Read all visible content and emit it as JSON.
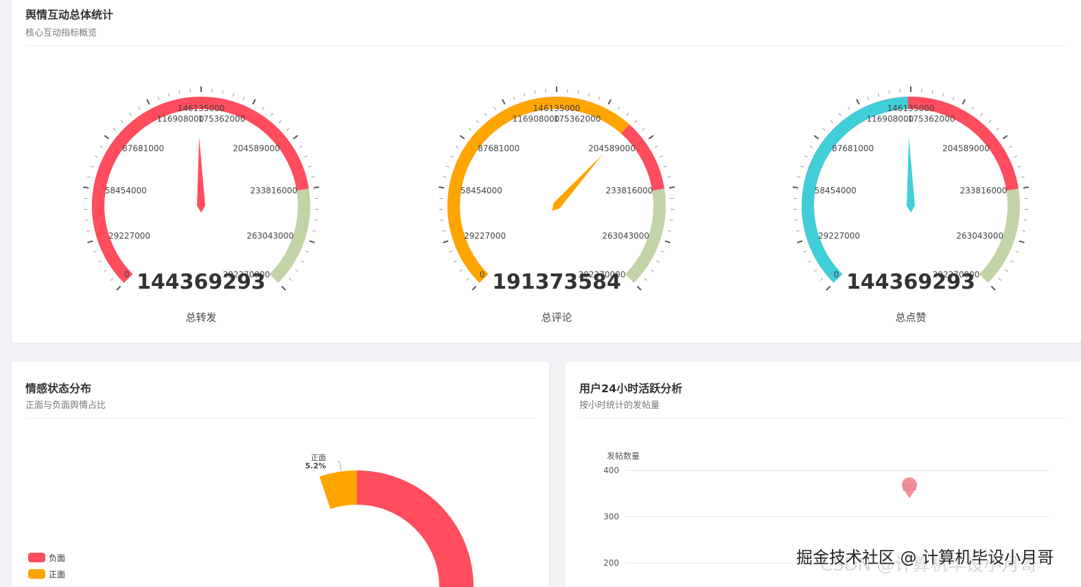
{
  "overview": {
    "title": "舆情互动总体统计",
    "subtitle": "核心互动指标概览",
    "gauge_axis": {
      "min": 0,
      "max": 292270000,
      "labels": [
        "0",
        "29227000",
        "58454000",
        "87681000",
        "116908000",
        "146135000",
        "175362000",
        "204589000",
        "233816000",
        "263043000",
        "292270000"
      ],
      "axis_colors": [
        "#ff4d5e",
        "#c3d3a8"
      ],
      "split_fraction": 0.8
    },
    "gauges": [
      {
        "label": "总转发",
        "value": 144369293,
        "value_text": "144369293",
        "color": "#ff4d5e"
      },
      {
        "label": "总评论",
        "value": 191373584,
        "value_text": "191373584",
        "color": "#ffa500"
      },
      {
        "label": "总点赞",
        "value": 144369293,
        "value_text": "144369293",
        "color": "#40cfd9"
      }
    ]
  },
  "sentiment": {
    "title": "情感状态分布",
    "subtitle": "正面与负面舆情占比",
    "chart_data": {
      "type": "pie",
      "series": [
        {
          "name": "负面",
          "value_pct": 94.8,
          "color": "#ff4d5e"
        },
        {
          "name": "正面",
          "value_pct": 5.2,
          "color": "#ffa500"
        }
      ],
      "label": {
        "name": "正面",
        "pct": "5.2%"
      },
      "legend": [
        "负面",
        "正面"
      ],
      "legend_position": "bottom-left"
    }
  },
  "activity": {
    "title": "用户24小时活跃分析",
    "subtitle": "按小时统计的发帖量",
    "chart_data": {
      "type": "line",
      "ylabel": "发帖数量",
      "yticks": [
        "200",
        "300",
        "400"
      ],
      "ylim_visible": [
        200,
        400
      ],
      "max_marker": {
        "value": 352,
        "text": "352"
      }
    }
  },
  "watermark": {
    "line1": "掘金技术社区 @ 计算机毕设小月哥",
    "line2": "CSDN @计算机毕设小月哥"
  }
}
